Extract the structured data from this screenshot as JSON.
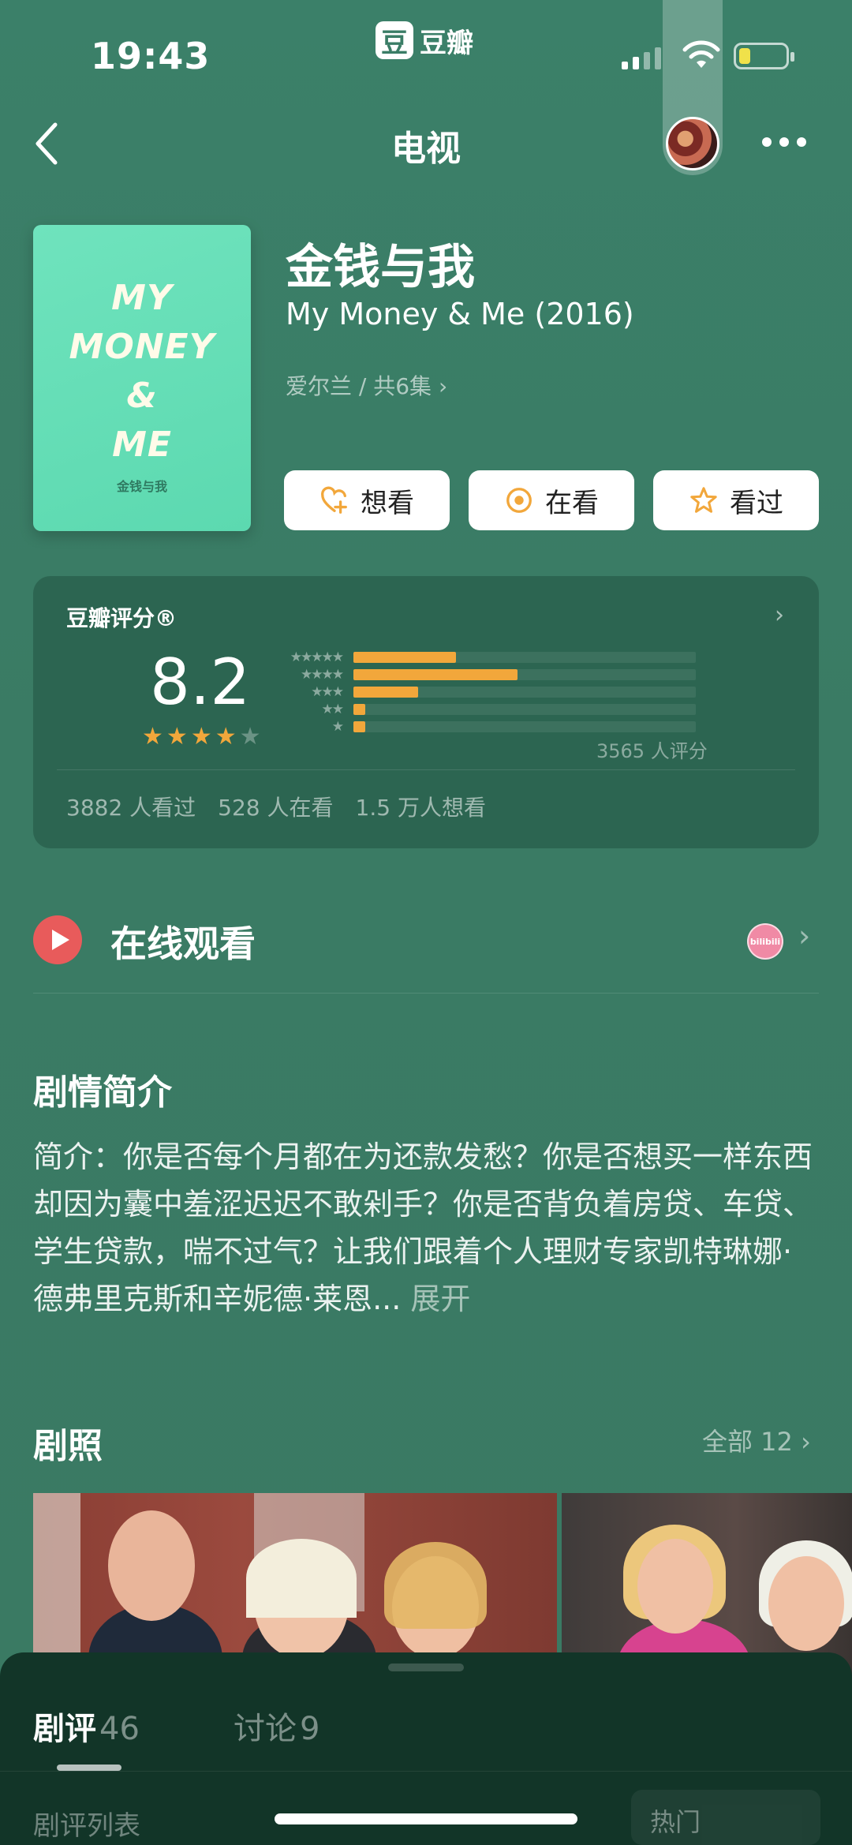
{
  "status_bar": {
    "time": "19:43",
    "app_badge_icon": "豆",
    "app_badge_text": "豆瓣"
  },
  "nav": {
    "title": "电视"
  },
  "show": {
    "title_cn": "金钱与我",
    "title_en": "My Money & Me (2016)",
    "meta": "爱尔兰 / 共6集 ›",
    "poster_title": "MY\nMONEY\n&\nME",
    "poster_subtitle": "金钱与我"
  },
  "actions": [
    {
      "label": "想看",
      "icon": "heart-plus-icon"
    },
    {
      "label": "在看",
      "icon": "target-icon"
    },
    {
      "label": "看过",
      "icon": "star-outline-icon"
    }
  ],
  "rating": {
    "label": "豆瓣评分®",
    "score": "8.2",
    "stars_filled": 4,
    "stars_total": 5,
    "distribution": [
      {
        "stars": "★★★★★",
        "fraction": 0.3
      },
      {
        "stars": "★★★★",
        "fraction": 0.48
      },
      {
        "stars": "★★★",
        "fraction": 0.19
      },
      {
        "stars": "★★",
        "fraction": 0.035
      },
      {
        "stars": "★",
        "fraction": 0.035
      }
    ],
    "count_text": "3565 人评分",
    "stats": [
      "3882 人看过",
      "528 人在看",
      "1.5 万人想看"
    ],
    "colors": {
      "bar": "#f2a73b",
      "stars": "#f2a73b"
    }
  },
  "watch": {
    "label": "在线观看",
    "provider": "bilibili"
  },
  "synopsis": {
    "title": "剧情简介",
    "text": "简介：你是否每个月都在为还款发愁？你是否想买一样东西却因为囊中羞涩迟迟不敢剁手？你是否背负着房贷、车贷、学生贷款，喘不过气？让我们跟着个人理财专家凯特琳娜·德弗里克斯和辛妮德·莱恩...",
    "more": " 展开"
  },
  "photos": {
    "title": "剧照",
    "more": "全部 12 ›"
  },
  "sheet": {
    "tabs": [
      {
        "label": "剧评",
        "count": "46"
      },
      {
        "label": "讨论",
        "count": "9"
      }
    ],
    "list_label": "剧评列表",
    "sort_label": "热门"
  }
}
